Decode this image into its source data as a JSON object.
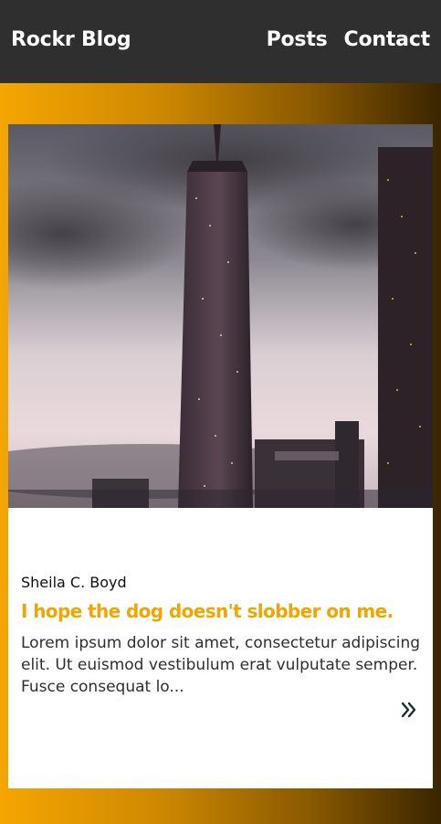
{
  "header": {
    "brand": "Rockr Blog",
    "nav": [
      {
        "label": "Posts"
      },
      {
        "label": "Contact"
      }
    ]
  },
  "post": {
    "author": "Sheila C. Boyd",
    "title": "I hope the dog doesn't slobber on me.",
    "excerpt": "Lorem ipsum dolor sit amet, consectetur adipiscing elit. Ut euismod vestibulum erat vulputate semper. Fusce consequat lo...",
    "more_icon": "double-chevron-right-icon",
    "image": "city-skyline-photo"
  },
  "colors": {
    "header_bg": "#2f2f2f",
    "accent": "#f0a500",
    "gradient_start": "#f5a600",
    "gradient_end": "#3a2500",
    "icon": "#1c2a3a"
  }
}
